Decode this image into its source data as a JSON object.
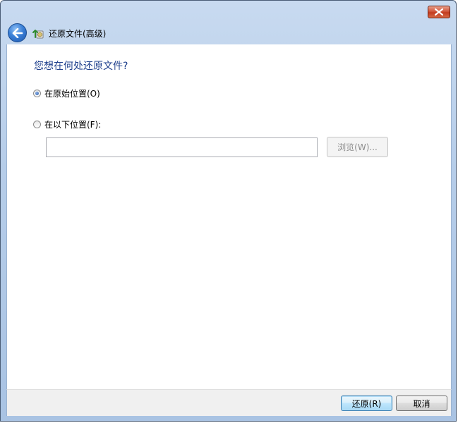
{
  "window": {
    "title": "还原文件(高级)",
    "close_icon": "close-icon",
    "back_icon": "back-arrow-icon",
    "app_icon": "restore-files-icon"
  },
  "main": {
    "question": "您想在何处还原文件?",
    "options": [
      {
        "label": "在原始位置(O)",
        "checked": true
      },
      {
        "label": "在以下位置(F):",
        "checked": false
      }
    ],
    "location_input": {
      "value": "",
      "placeholder": ""
    },
    "browse_label": "浏览(W)..."
  },
  "footer": {
    "restore_label": "还原(R)",
    "cancel_label": "取消"
  },
  "colors": {
    "title_bar": "#b6cde9",
    "question_text": "#1e3f8c",
    "close_button": "#c23b1f",
    "default_button_border": "#3c7fb1"
  }
}
